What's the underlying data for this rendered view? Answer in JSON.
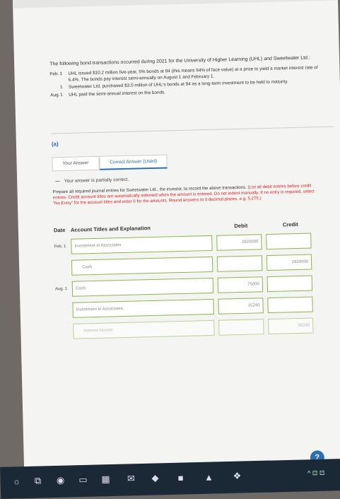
{
  "topbar": {
    "text": "..., ... —"
  },
  "intro": "The following bond transactions occurred during 2021 for the University of Higher Learning (UHL) and Sweetwater Ltd.:",
  "transactions": [
    {
      "month": "Feb.",
      "day": "1",
      "text": "UHL issued $10.2 million five-year, 5% bonds at 94 (this means 94% of face value) at a price to yield a market interest rate of 6.4%. The bonds pay interest semi-annually on August 1 and February 1."
    },
    {
      "month": "",
      "day": "1",
      "text": "Sweetwater Ltd. purchased $3.0 million of UHL's bonds at 94 as a long-term investment to be held to maturity."
    },
    {
      "month": "Aug.",
      "day": "1",
      "text": "UHL paid the semi-annual interest on the bonds."
    }
  ],
  "part": "(a)",
  "tabs": [
    "Your Answer",
    "Correct Answer (Used)"
  ],
  "partial_msg": "Your answer is partially correct.",
  "instructions": {
    "black1": "Prepare all required journal entries for Sweetwater Ltd., the investor, to record the above transactions.",
    "red": "(List all debit entries before credit entries. Credit account titles are automatically indented when the amount is entered. Do not indent manually. If no entry is required, select \"No Entry\" for the account titles and enter 0 for the amounts. Round answers to 0 decimal places, e.g. 5,275.)"
  },
  "journal": {
    "headers": {
      "date": "Date",
      "account": "Account Titles and Explanation",
      "debit": "Debit",
      "credit": "Credit"
    },
    "rows": [
      {
        "date": "Feb. 1",
        "account": "Investment in Associates",
        "debit": "2820000",
        "credit": ""
      },
      {
        "date": "",
        "account": "Cash",
        "debit": "",
        "credit": "2820000"
      },
      {
        "date": "Aug. 1",
        "account": "Cash",
        "debit": "75000",
        "credit": ""
      },
      {
        "date": "",
        "account": "Investment in Associates",
        "debit": "15240",
        "credit": ""
      },
      {
        "date": "",
        "account": "Interest Income",
        "debit": "",
        "credit": "90240"
      }
    ]
  },
  "help_label": "?",
  "tray": "^ ⊡ ⊡"
}
